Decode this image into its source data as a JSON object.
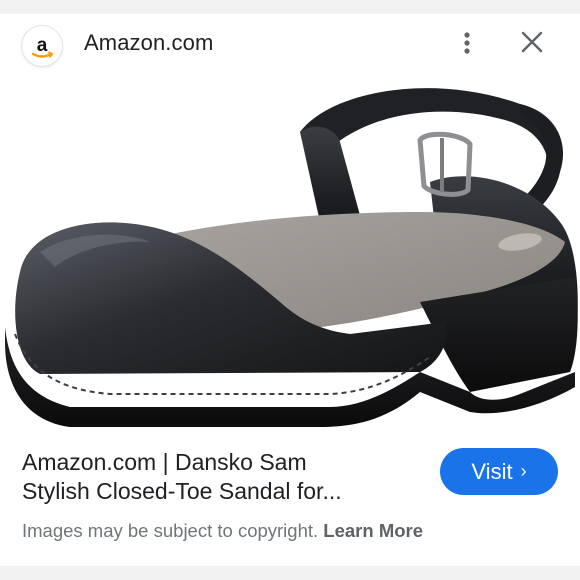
{
  "header": {
    "favicon_icon": "amazon-logo-icon",
    "favicon_letter": "a",
    "site_name": "Amazon.com",
    "more_icon": "more-vert-icon",
    "close_icon": "close-icon"
  },
  "image": {
    "icon": "product-image-sandal"
  },
  "result": {
    "title_line1": "Amazon.com | Dansko Sam",
    "title_line2": "Stylish Closed-Toe Sandal for..."
  },
  "visit_button": {
    "label": "Visit",
    "chevron": "›"
  },
  "footer": {
    "copyright_text": "Images may be subject to copyright.",
    "learn_more": "Learn More"
  },
  "colors": {
    "accent": "#1a73e8",
    "text_primary": "#202124",
    "text_secondary": "#70757a"
  }
}
